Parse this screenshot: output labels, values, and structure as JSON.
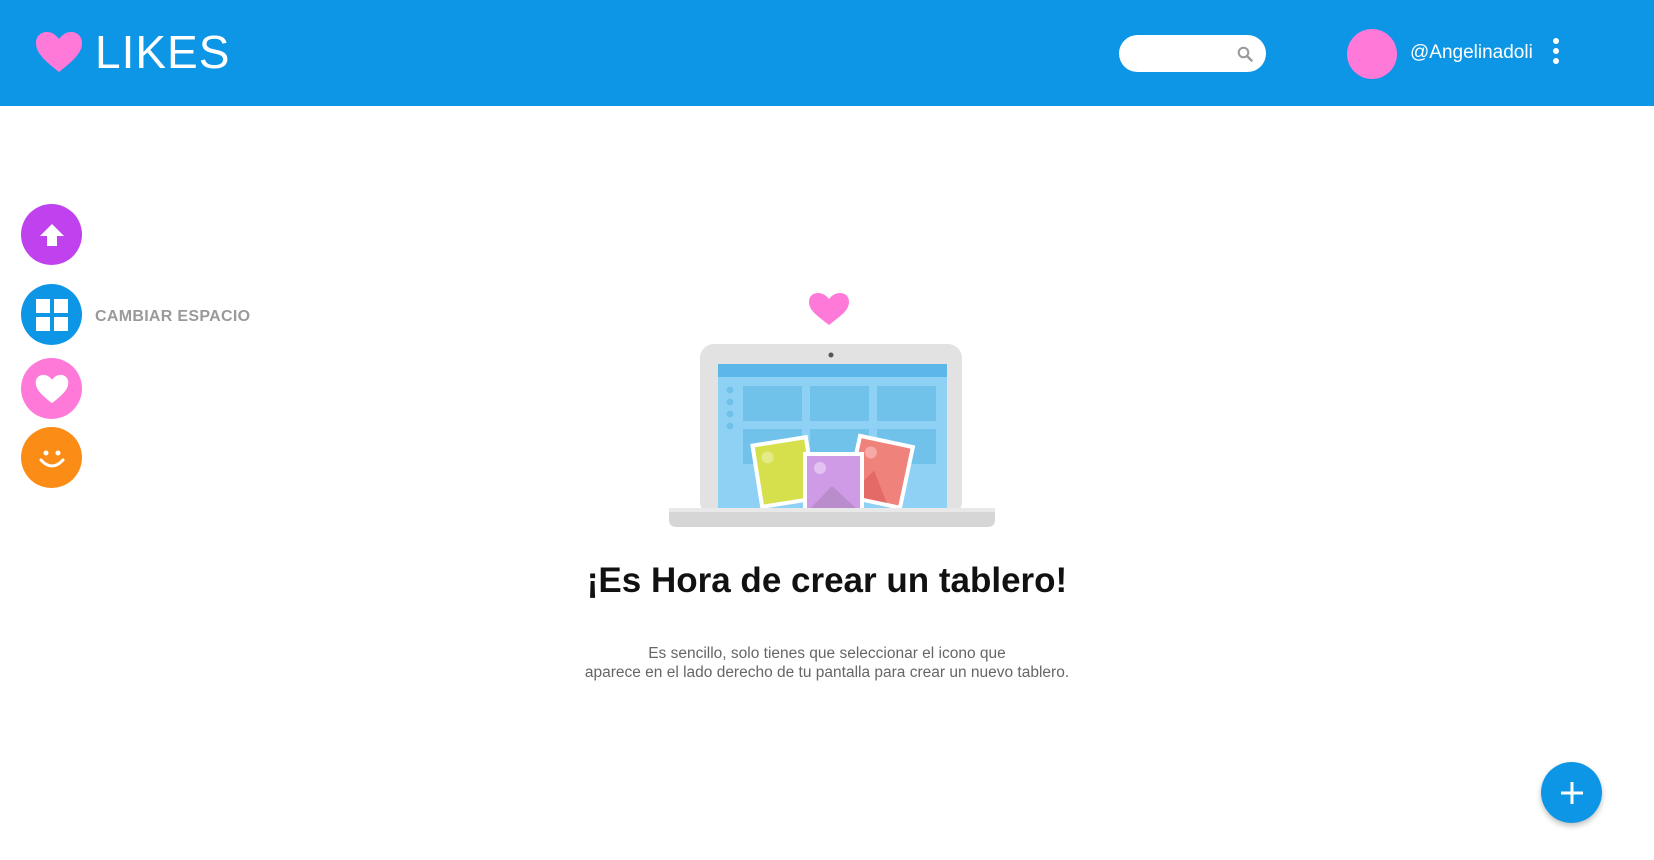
{
  "app": {
    "name": "LIKES",
    "brand_color": "#0d96e6",
    "accent_pink": "#ff79d9"
  },
  "header": {
    "logo_icon": "heart-icon",
    "search": {
      "placeholder": "",
      "icon": "search-icon"
    },
    "user": {
      "handle": "@Angelinadoli",
      "avatar_color": "#ff79d9"
    },
    "menu_icon": "kebab-menu-icon"
  },
  "sidebar": {
    "items": [
      {
        "icon": "arrow-up-icon",
        "color": "#c041ee",
        "label": ""
      },
      {
        "icon": "grid-icon",
        "color": "#0d96e6",
        "label": "CAMBIAR ESPACIO"
      },
      {
        "icon": "heart-icon",
        "color": "#ff79d9",
        "label": ""
      },
      {
        "icon": "smiley-icon",
        "color": "#fb8c15",
        "label": ""
      }
    ]
  },
  "empty_state": {
    "illustration": "laptop-with-photos-illustration",
    "title": "¡Es Hora de crear un tablero!",
    "line1": "Es sencillo, solo tienes que seleccionar el icono que",
    "line2": "aparece en el lado derecho de tu pantalla para crear un nuevo tablero."
  },
  "fab": {
    "icon": "plus-icon",
    "color": "#0d96e6"
  }
}
